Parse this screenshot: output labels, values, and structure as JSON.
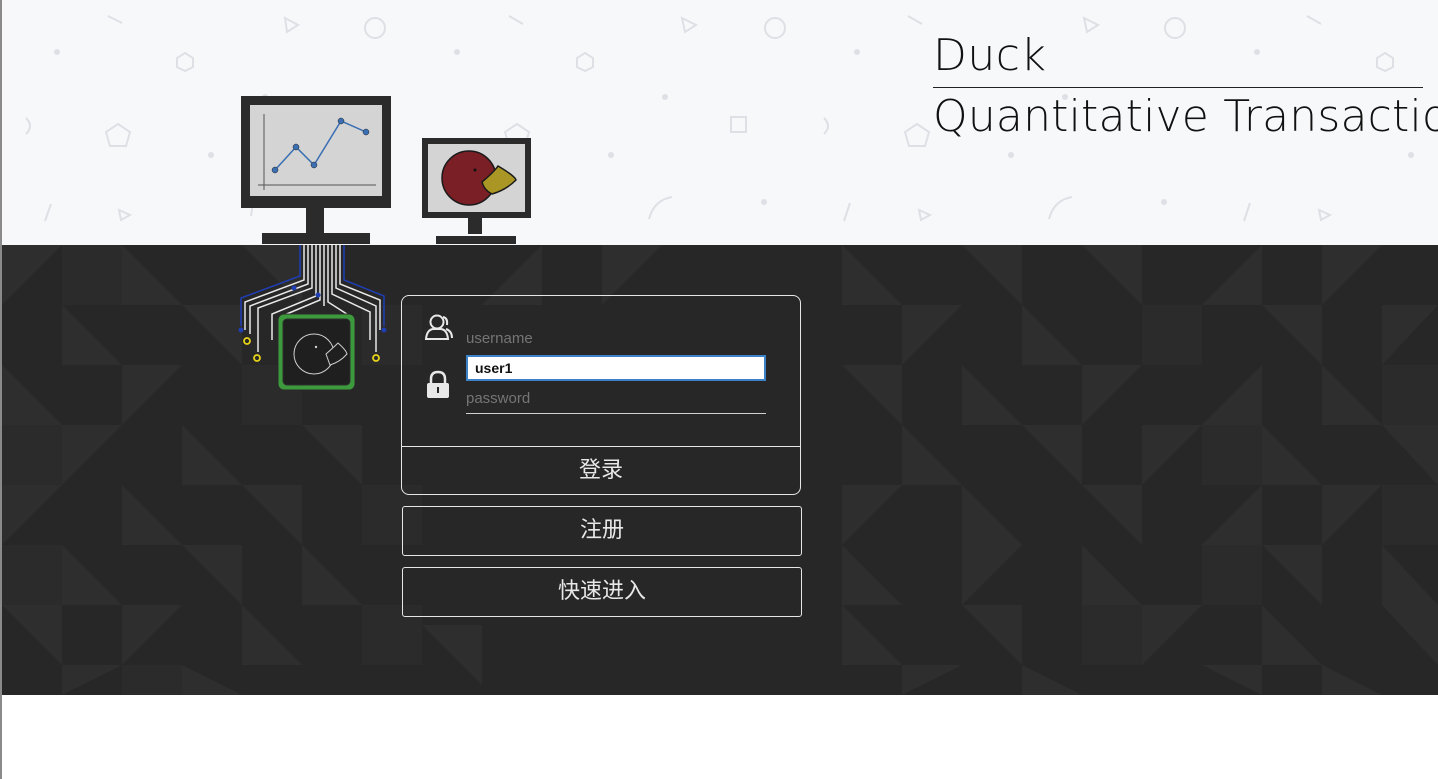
{
  "brand": {
    "title": "Duck",
    "subtitle": "Quantitative Transaction"
  },
  "login": {
    "username_placeholder": "username",
    "username_icon": "user-icon",
    "password_placeholder": "password",
    "password_icon": "lock-icon",
    "autocomplete_suggestion": "user1",
    "login_label": "登录"
  },
  "actions": {
    "register_label": "注册",
    "quick_enter_label": "快速进入"
  },
  "colors": {
    "top_background": "#f7f8fa",
    "dark_background": "#272727",
    "text_light": "#e8e8e8",
    "focus_border": "#3b82c8",
    "chip_green": "#3c9a3c",
    "duck_red": "#7a1f25",
    "duck_beak": "#a99624"
  }
}
